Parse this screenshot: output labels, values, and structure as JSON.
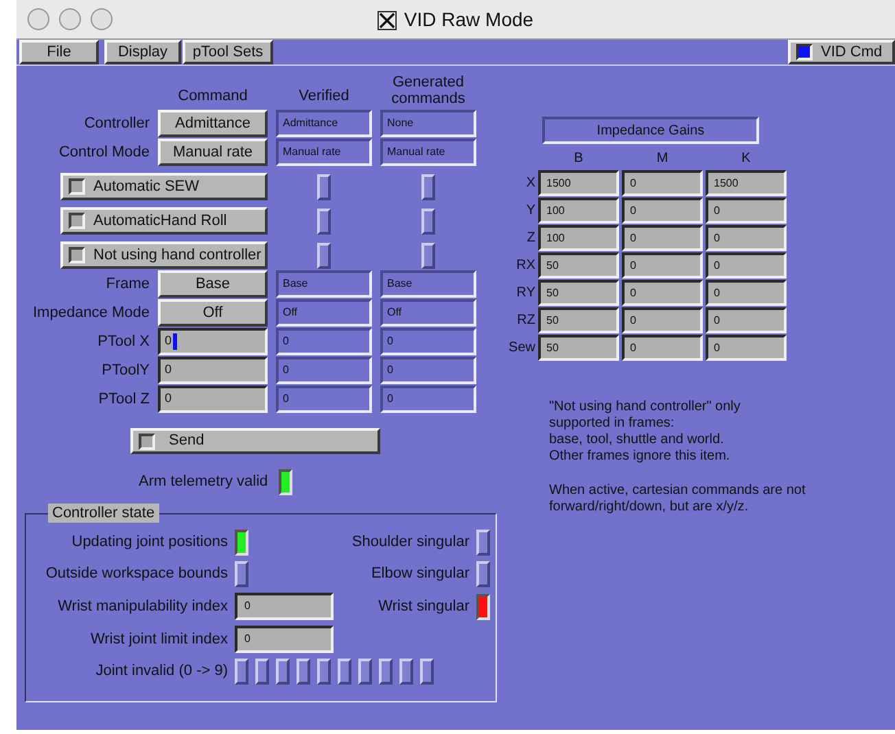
{
  "window": {
    "title": "VID Raw Mode"
  },
  "menu": [
    "File",
    "Display",
    "pTool Sets"
  ],
  "vid_cmd": {
    "label": "VID Cmd",
    "checked": true
  },
  "headers": {
    "command": "Command",
    "verified": "Verified",
    "generated": "Generated commands"
  },
  "rows": [
    {
      "kind": "button",
      "label": "Controller",
      "command": "Admittance",
      "verified": "Admittance",
      "generated": "None"
    },
    {
      "kind": "button",
      "label": "Control Mode",
      "command": "Manual rate",
      "verified": "Manual rate",
      "generated": "Manual rate"
    },
    {
      "kind": "toggle",
      "command": "Automatic SEW",
      "checked": false,
      "verified_on": false,
      "generated_on": false
    },
    {
      "kind": "toggle",
      "command": "AutomaticHand Roll",
      "checked": false,
      "verified_on": false,
      "generated_on": false
    },
    {
      "kind": "toggle",
      "command": "Not using hand controller",
      "checked": false,
      "verified_on": false,
      "generated_on": false
    },
    {
      "kind": "button",
      "label": "Frame",
      "command": "Base",
      "verified": "Base",
      "generated": "Base"
    },
    {
      "kind": "button",
      "label": "Impedance Mode",
      "command": "Off",
      "verified": "Off",
      "generated": "Off"
    },
    {
      "kind": "field",
      "label": "PTool X",
      "command": "0",
      "focused": true,
      "verified": "0",
      "generated": "0"
    },
    {
      "kind": "field",
      "label": "PToolY",
      "command": "0",
      "focused": false,
      "verified": "0",
      "generated": "0"
    },
    {
      "kind": "field",
      "label": "PTool Z",
      "command": "0",
      "focused": false,
      "verified": "0",
      "generated": "0"
    }
  ],
  "send": {
    "label": "Send",
    "checked": false
  },
  "arm_telemetry": {
    "label": "Arm telemetry valid",
    "on": true,
    "color": "#22ee22"
  },
  "controller_state": {
    "title": "Controller state",
    "left": [
      {
        "kind": "indicator",
        "label": "Updating joint positions",
        "on": true,
        "color": "#22ee22"
      },
      {
        "kind": "indicator",
        "label": "Outside workspace bounds",
        "on": false
      },
      {
        "kind": "field",
        "label": "Wrist manipulability index",
        "value": "0"
      },
      {
        "kind": "field",
        "label": "Wrist joint limit index",
        "value": "0"
      }
    ],
    "right": [
      {
        "label": "Shoulder singular",
        "on": false
      },
      {
        "label": "Elbow singular",
        "on": false
      },
      {
        "label": "Wrist singular",
        "on": true,
        "color": "#ff1010"
      }
    ],
    "joint_invalid": {
      "label": "Joint invalid (0 -> 9)",
      "joints": [
        {
          "on": false
        },
        {
          "on": false
        },
        {
          "on": false
        },
        {
          "on": false
        },
        {
          "on": false
        },
        {
          "on": false
        },
        {
          "on": false
        },
        {
          "on": false
        },
        {
          "on": false
        },
        {
          "on": false
        }
      ]
    }
  },
  "impedance_gains": {
    "title": "Impedance Gains",
    "columns": [
      "B",
      "M",
      "K"
    ],
    "rows": [
      {
        "label": "X",
        "values": [
          "1500",
          "0",
          "1500"
        ]
      },
      {
        "label": "Y",
        "values": [
          "100",
          "0",
          "0"
        ]
      },
      {
        "label": "Z",
        "values": [
          "100",
          "0",
          "0"
        ]
      },
      {
        "label": "RX",
        "values": [
          "50",
          "0",
          "0"
        ]
      },
      {
        "label": "RY",
        "values": [
          "50",
          "0",
          "0"
        ]
      },
      {
        "label": "RZ",
        "values": [
          "50",
          "0",
          "0"
        ]
      },
      {
        "label": "Sew",
        "values": [
          "50",
          "0",
          "0"
        ]
      }
    ]
  },
  "note": [
    [
      "\"Not using hand controller\" only",
      "supported in frames:",
      "base, tool, shuttle and world.",
      "Other frames ignore this item."
    ],
    [
      "When active, cartesian commands are not",
      "forward/right/down, but are x/y/z."
    ]
  ]
}
